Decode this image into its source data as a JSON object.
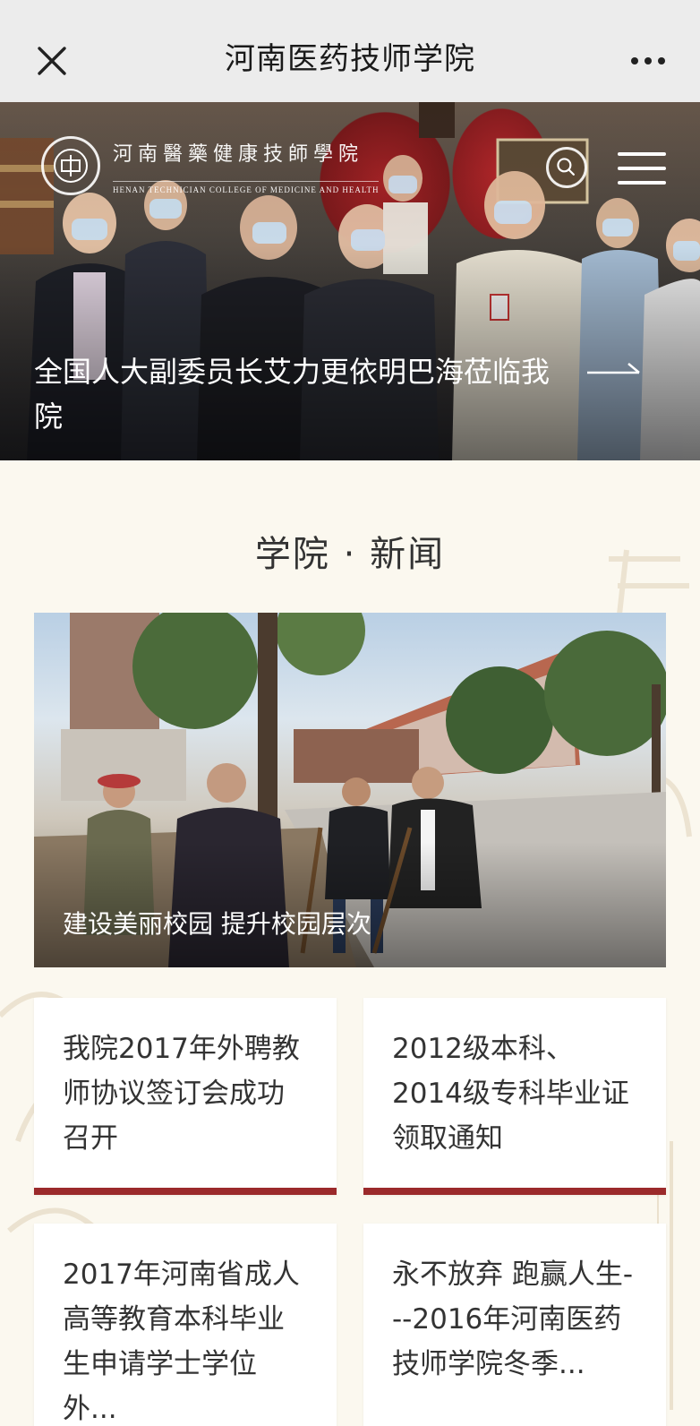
{
  "topbar": {
    "title": "河南医药技师学院"
  },
  "hero": {
    "logo_cn": "河南醫藥健康技師學院",
    "logo_en": "HENAN TECHNICIAN COLLEGE OF MEDICINE AND HEALTH",
    "headline": "全国人大副委员长艾力更依明巴海莅临我院"
  },
  "news": {
    "section_title": "学院 · 新闻",
    "feature_caption": "建设美丽校园 提升校园层次",
    "cards": [
      {
        "text": "我院2017年外聘教师协议签订会成功召开"
      },
      {
        "text": "2012级本科、2014级专科毕业证领取通知"
      },
      {
        "text": "2017年河南省成人高等教育本科毕业生申请学士学位外..."
      },
      {
        "text": "永不放弃 跑赢人生---2016年河南医药技师学院冬季..."
      }
    ]
  },
  "colors": {
    "accent": "#9b2a2b",
    "page_bg": "#fbf8ef",
    "topbar_bg": "#ececec"
  },
  "icons": {
    "close": "close-icon",
    "more": "more-dots-icon",
    "search": "search-icon",
    "menu": "menu-icon",
    "arrow": "arrow-right-icon"
  }
}
